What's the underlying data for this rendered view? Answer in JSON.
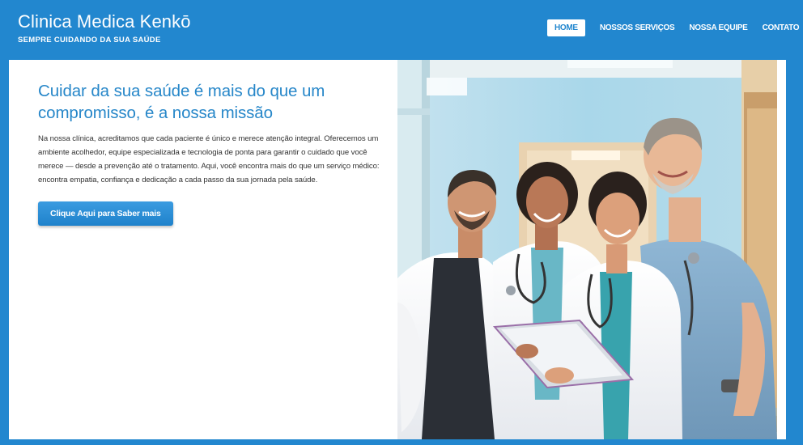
{
  "header": {
    "brand": "Clinica Medica Kenkō",
    "tagline": "SEMPRE CUIDANDO DA SUA SAÚDE",
    "nav": [
      {
        "label": "HOME",
        "active": true
      },
      {
        "label": "NOSSOS SERVIÇOS",
        "active": false
      },
      {
        "label": "NOSSA EQUIPE",
        "active": false
      },
      {
        "label": "CONTATO",
        "active": false
      }
    ]
  },
  "hero": {
    "headline": "Cuidar da sua saúde é mais do que um compromisso, é a nossa missão",
    "paragraph": "Na nossa clínica, acreditamos que cada paciente é único e merece atenção integral. Oferecemos um ambiente acolhedor, equipe especializada e tecnologia de ponta para garantir o cuidado que você merece — desde a prevenção até o tratamento. Aqui, você encontra mais do que um serviço médico: encontra empatia, confiança e dedicação a cada passo da sua jornada pela saúde.",
    "cta_label": "Clique Aqui para Saber mais"
  },
  "photo": {
    "subject": "smiling-medical-team-photo"
  },
  "colors": {
    "brand_blue": "#2287cf",
    "headline_blue": "#2787c9",
    "text": "#333333",
    "background": "#ffffff"
  }
}
